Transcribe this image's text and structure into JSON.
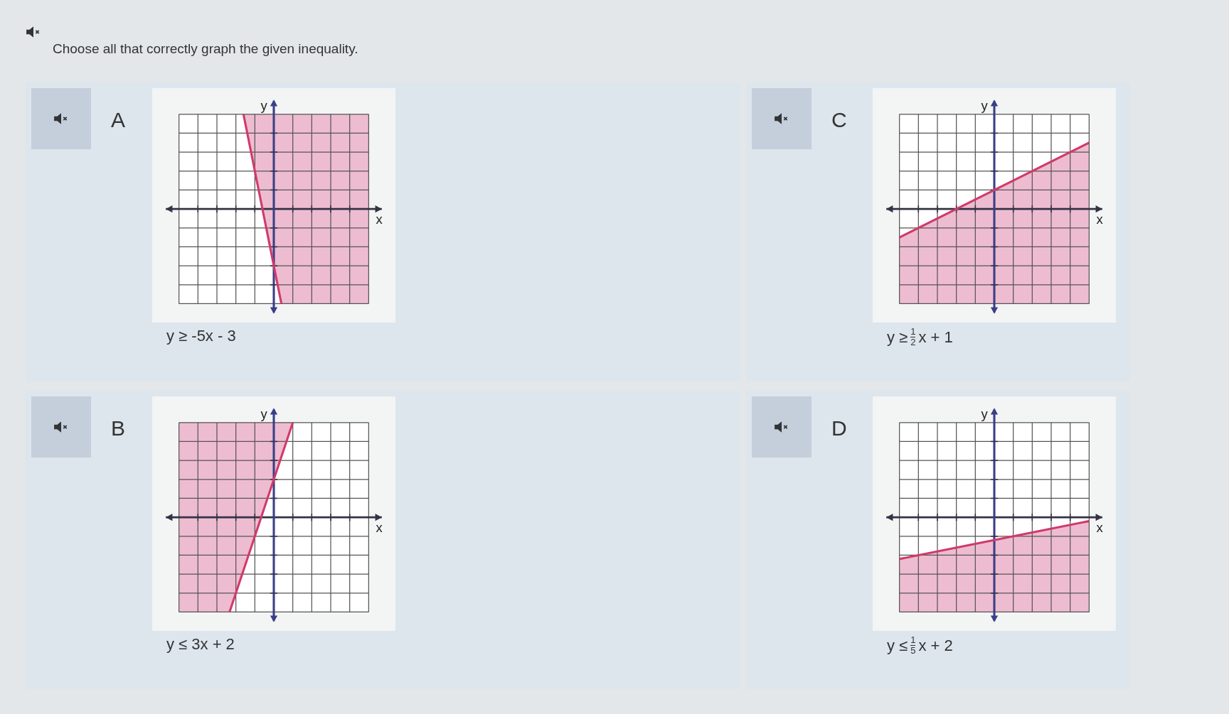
{
  "instruction": "Choose all that correctly graph the given inequality.",
  "options": [
    {
      "letter": "A",
      "shaded_above": true,
      "x_label": "x",
      "y_label": "y",
      "inequality": {
        "kind": "plain",
        "text": "y ≥ -5x - 3"
      }
    },
    {
      "letter": "C",
      "shaded_above": false,
      "x_label": "x",
      "y_label": "y",
      "inequality": {
        "kind": "fraction",
        "prefix": "y ≥",
        "numerator": "1",
        "denominator": "2",
        "suffix": "x + 1"
      }
    },
    {
      "letter": "B",
      "shaded_above": true,
      "x_label": "x",
      "y_label": "y",
      "inequality": {
        "kind": "plain",
        "text": "y ≤ 3x + 2"
      }
    },
    {
      "letter": "D",
      "shaded_above": false,
      "x_label": "x",
      "y_label": "y",
      "inequality": {
        "kind": "fraction",
        "prefix": "y ≤",
        "numerator": "1",
        "denominator": "5",
        "suffix": "x + 2"
      }
    }
  ]
}
